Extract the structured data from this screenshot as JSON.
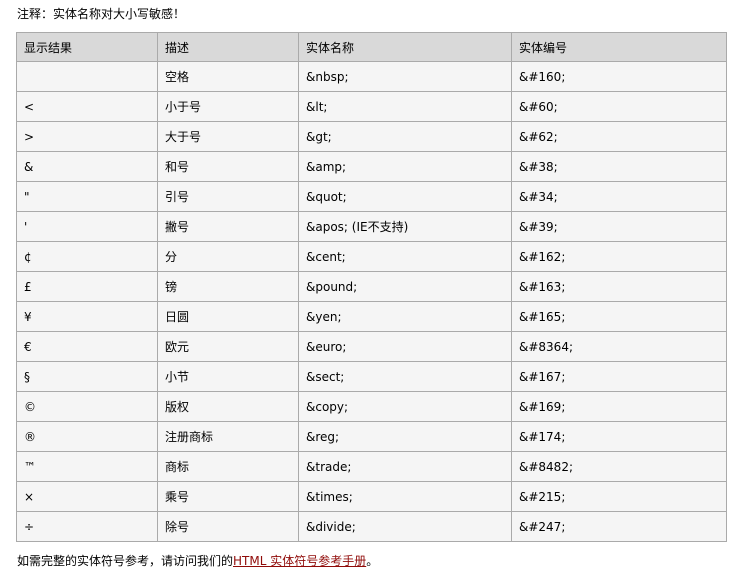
{
  "note": "注释：实体名称对大小写敏感！",
  "table": {
    "headers": [
      "显示结果",
      "描述",
      "实体名称",
      "实体编号"
    ],
    "rows": [
      {
        "result": "",
        "desc": "空格",
        "name": "&nbsp;",
        "number": "&#160;"
      },
      {
        "result": "<",
        "desc": "小于号",
        "name": "&lt;",
        "number": "&#60;"
      },
      {
        "result": ">",
        "desc": "大于号",
        "name": "&gt;",
        "number": "&#62;"
      },
      {
        "result": "&",
        "desc": "和号",
        "name": "&amp;",
        "number": "&#38;"
      },
      {
        "result": "\"",
        "desc": "引号",
        "name": "&quot;",
        "number": "&#34;"
      },
      {
        "result": "'",
        "desc": "撇号",
        "name": "&apos; (IE不支持)",
        "number": "&#39;"
      },
      {
        "result": "¢",
        "desc": "分",
        "name": "&cent;",
        "number": "&#162;"
      },
      {
        "result": "£",
        "desc": "镑",
        "name": "&pound;",
        "number": "&#163;"
      },
      {
        "result": "¥",
        "desc": "日圆",
        "name": "&yen;",
        "number": "&#165;"
      },
      {
        "result": "€",
        "desc": "欧元",
        "name": "&euro;",
        "number": "&#8364;"
      },
      {
        "result": "§",
        "desc": "小节",
        "name": "&sect;",
        "number": "&#167;"
      },
      {
        "result": "©",
        "desc": "版权",
        "name": "&copy;",
        "number": "&#169;"
      },
      {
        "result": "®",
        "desc": "注册商标",
        "name": "&reg;",
        "number": "&#174;"
      },
      {
        "result": "™",
        "desc": "商标",
        "name": "&trade;",
        "number": "&#8482;"
      },
      {
        "result": "×",
        "desc": "乘号",
        "name": "&times;",
        "number": "&#215;"
      },
      {
        "result": "÷",
        "desc": "除号",
        "name": "&divide;",
        "number": "&#247;"
      }
    ]
  },
  "footer": {
    "prefix": "如需完整的实体符号参考，请访问我们的",
    "link_text": "HTML 实体符号参考手册",
    "suffix": "。"
  },
  "colors": {
    "header_bg": "#d9d9d9",
    "cell_bg": "#f5f5f5",
    "border": "#aaaaaa",
    "link": "#900b09"
  }
}
